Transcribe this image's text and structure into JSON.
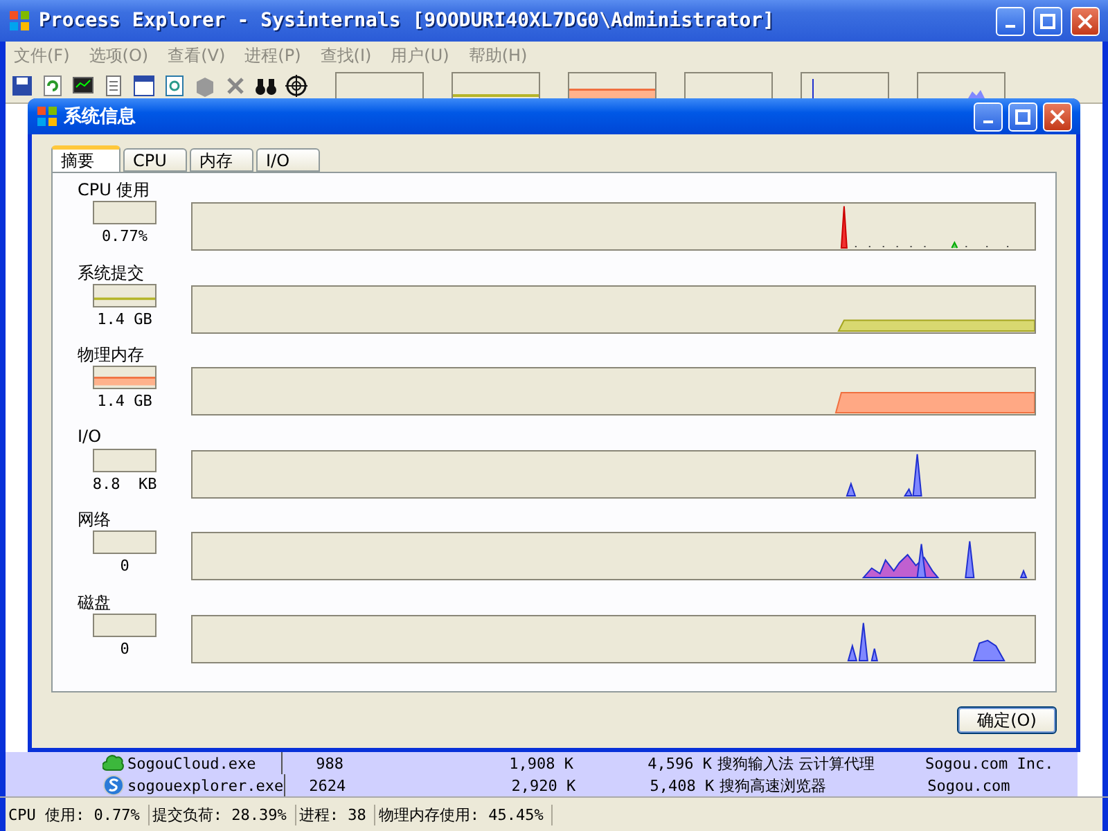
{
  "main_window": {
    "title": "Process Explorer - Sysinternals [9OODURI40XL7DG0\\Administrator]"
  },
  "menu": [
    "文件(F)",
    "选项(O)",
    "查看(V)",
    "进程(P)",
    "查找(I)",
    "用户(U)",
    "帮助(H)"
  ],
  "dialog": {
    "title": "系统信息",
    "tabs": [
      {
        "label": "摘要",
        "selected": true
      },
      {
        "label": "CPU",
        "selected": false
      },
      {
        "label": "内存",
        "selected": false
      },
      {
        "label": "I/O",
        "selected": false
      }
    ],
    "graphs": [
      {
        "kind": "cpu",
        "label": "CPU 使用",
        "value": "0.77%"
      },
      {
        "kind": "commit",
        "label": "系统提交",
        "value": "1.4 GB"
      },
      {
        "kind": "physical",
        "label": "物理内存",
        "value": "1.4 GB"
      },
      {
        "kind": "io",
        "label": "I/O",
        "value": "8.8  KB"
      },
      {
        "kind": "network",
        "label": "网络",
        "value": "0"
      },
      {
        "kind": "disk",
        "label": "磁盘",
        "value": "0"
      }
    ],
    "ok_button": "确定(O)"
  },
  "processes": [
    {
      "kind": "cloud",
      "column_1": "SogouCloud.exe",
      "column_2": "988",
      "column_3": "1,908 K",
      "column_4": "4,596 K",
      "column_5": "搜狗输入法 云计算代理",
      "column_6": "Sogou.com Inc."
    },
    {
      "kind": "browser",
      "column_1": "sogouexplorer.exe",
      "column_2": "2624",
      "column_3": "2,920 K",
      "column_4": "5,408 K",
      "column_5": "搜狗高速浏览器",
      "column_6": "Sogou.com"
    }
  ],
  "status_bar": [
    "CPU 使用: 0.77%",
    "提交负荷: 28.39%",
    "进程: 38",
    "物理内存使用: 45.45%"
  ]
}
